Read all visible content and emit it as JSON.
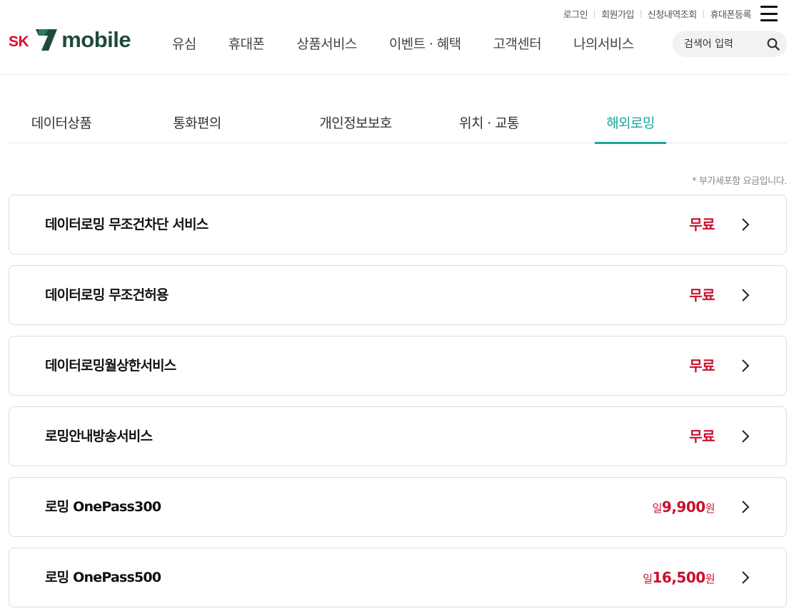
{
  "header": {
    "util_links": [
      "로그인",
      "회원가입",
      "신청내역조회",
      "휴대폰등록"
    ],
    "logo": {
      "sk": "SK",
      "text": "mobile"
    },
    "gnb": [
      "유심",
      "휴대폰",
      "상품서비스",
      "이벤트 · 혜택",
      "고객센터",
      "나의서비스"
    ],
    "search": {
      "placeholder": "검색어 입력",
      "value": ""
    }
  },
  "tabs": [
    {
      "label": "데이터상품",
      "active": false
    },
    {
      "label": "통화편의",
      "active": false
    },
    {
      "label": "개인정보보호",
      "active": false
    },
    {
      "label": "위치 · 교통",
      "active": false
    },
    {
      "label": "해외로밍",
      "active": true
    }
  ],
  "vat_note": "* 부가세포함 요금입니다.",
  "services": [
    {
      "name": "데이터로밍 무조건차단 서비스",
      "price_prefix": "",
      "price": "무료",
      "price_suffix": ""
    },
    {
      "name": "데이터로밍 무조건허용",
      "price_prefix": "",
      "price": "무료",
      "price_suffix": ""
    },
    {
      "name": "데이터로밍월상한서비스",
      "price_prefix": "",
      "price": "무료",
      "price_suffix": ""
    },
    {
      "name": "로밍안내방송서비스",
      "price_prefix": "",
      "price": "무료",
      "price_suffix": ""
    },
    {
      "name": "로밍 OnePass300",
      "price_prefix": "일",
      "price": "9,900",
      "price_suffix": "원"
    },
    {
      "name": "로밍 OnePass500",
      "price_prefix": "일",
      "price": "16,500",
      "price_suffix": "원"
    }
  ],
  "colors": {
    "accent": "#1aa69b",
    "price": "#c8102e",
    "logo_red": "#e4002b",
    "logo_green": "#1e4a3e"
  }
}
